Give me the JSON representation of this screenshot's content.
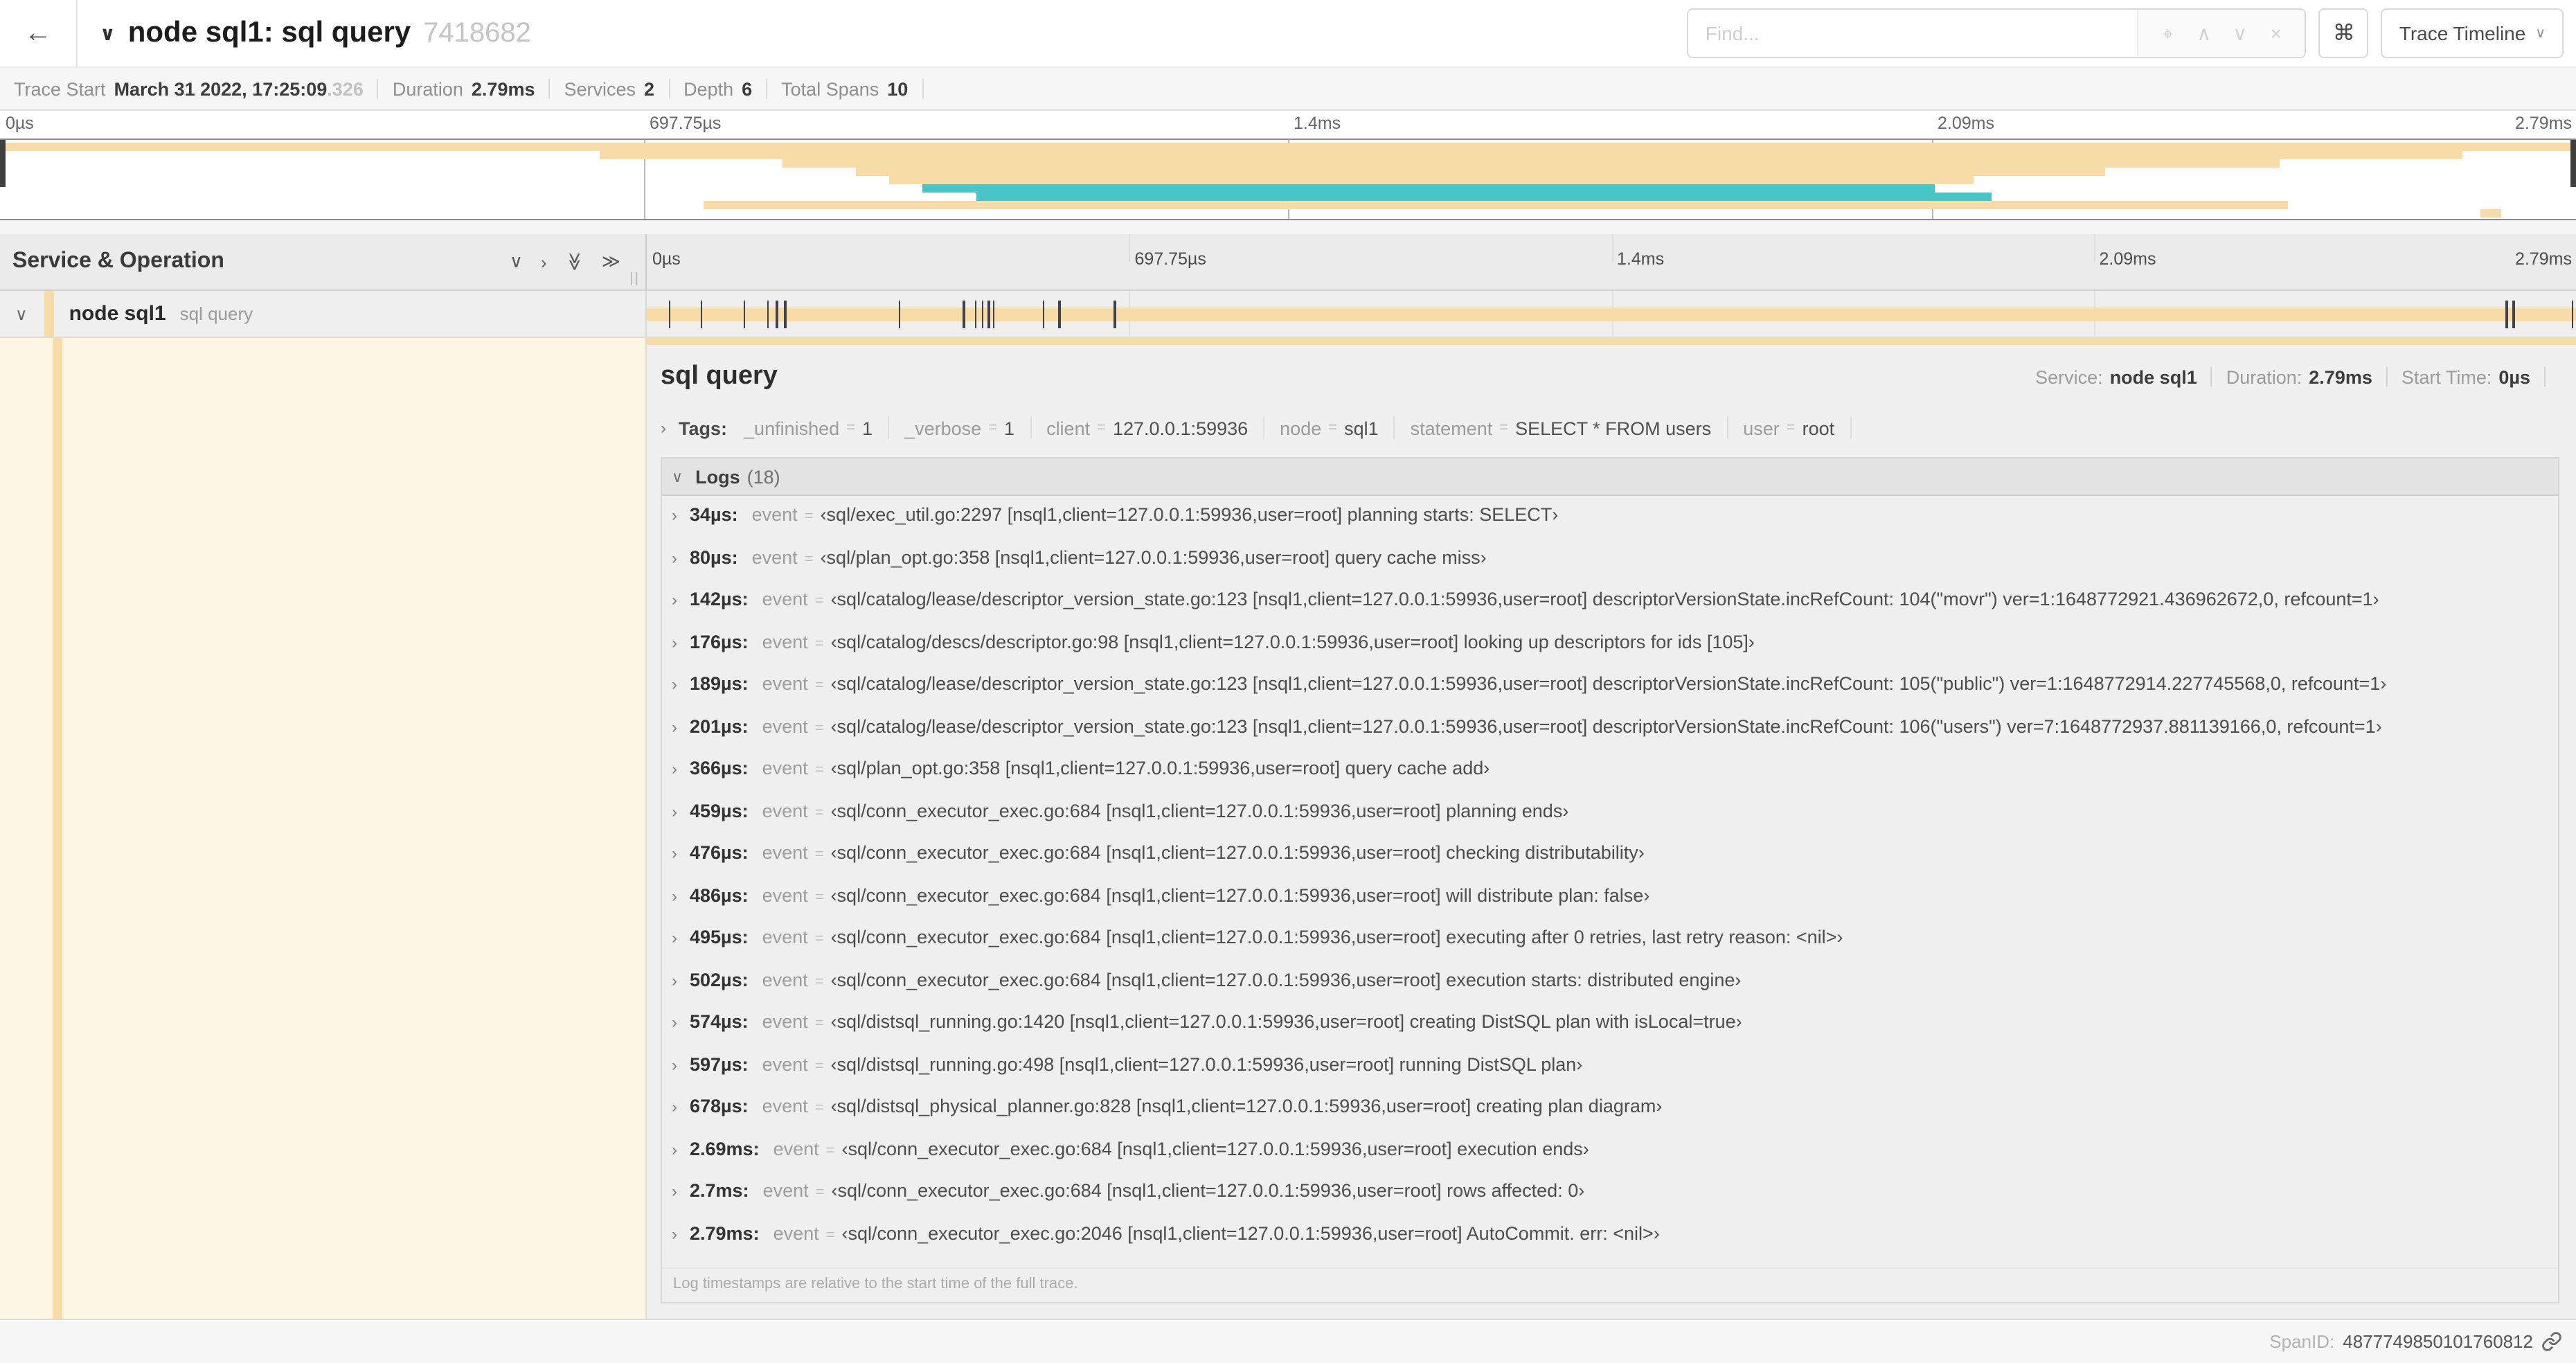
{
  "header": {
    "back_icon": "←",
    "collapse_icon": "∨",
    "title": "node sql1: sql query",
    "trace_id": "7418682",
    "find_placeholder": "Find...",
    "find_icons": [
      "⌖",
      "∧",
      "∨",
      "×"
    ],
    "shortcut_icon": "⌘",
    "view_selector": "Trace Timeline",
    "view_caret": "∨"
  },
  "summary": {
    "items": [
      {
        "label": "Trace Start",
        "value": "March 31 2022, 17:25:09",
        "extra": ".326"
      },
      {
        "label": "Duration",
        "value": "2.79ms",
        "extra": ""
      },
      {
        "label": "Services",
        "value": "2",
        "extra": ""
      },
      {
        "label": "Depth",
        "value": "6",
        "extra": ""
      },
      {
        "label": "Total Spans",
        "value": "10",
        "extra": ""
      }
    ]
  },
  "timeline": {
    "ticks": [
      {
        "label": "0µs",
        "pct": 0
      },
      {
        "label": "697.75µs",
        "pct": 25
      },
      {
        "label": "1.4ms",
        "pct": 50
      },
      {
        "label": "2.09ms",
        "pct": 75
      },
      {
        "label": "2.79ms",
        "pct": 100
      }
    ]
  },
  "colors": {
    "span_beige": "#f7dca8",
    "span_teal": "#48c5c7"
  },
  "minimap": {
    "rows": [
      {
        "start": 0,
        "end": 100,
        "color": "beige"
      },
      {
        "start": 23.3,
        "end": 95.6,
        "color": "beige"
      },
      {
        "start": 30.4,
        "end": 88.5,
        "color": "beige"
      },
      {
        "start": 33.2,
        "end": 81.7,
        "color": "beige"
      },
      {
        "start": 34.5,
        "end": 76.6,
        "color": "beige"
      },
      {
        "start": 35.8,
        "end": 75.1,
        "color": "teal"
      },
      {
        "start": 37.9,
        "end": 77.3,
        "color": "teal"
      },
      {
        "start": 27.3,
        "end": 88.8,
        "color": "beige"
      },
      {
        "start": 96.3,
        "end": 97.1,
        "color": "beige"
      }
    ]
  },
  "span_table": {
    "column_header": "Service & Operation",
    "collapse_icon": "∨",
    "expand_icon": "›",
    "collapse_all_icon": "≫",
    "expand_all_icon": "≫",
    "row_caret": "∨",
    "service": "node sql1",
    "operation": "sql query",
    "log_marker_pcts": [
      1.22,
      2.87,
      5.09,
      6.31,
      6.77,
      7.2,
      13.12,
      16.45,
      17.06,
      17.42,
      17.74,
      18.0,
      20.57,
      21.4,
      24.3,
      96.42,
      96.77,
      99.85
    ]
  },
  "detail": {
    "title": "sql query",
    "meta": [
      {
        "label": "Service:",
        "value": "node sql1"
      },
      {
        "label": "Duration:",
        "value": "2.79ms"
      },
      {
        "label": "Start Time:",
        "value": "0µs"
      }
    ],
    "tags_caret": "›",
    "tags_label": "Tags:",
    "tags": [
      {
        "key": "_unfinished",
        "value": "1"
      },
      {
        "key": "_verbose",
        "value": "1"
      },
      {
        "key": "client",
        "value": "127.0.0.1:59936"
      },
      {
        "key": "node",
        "value": "sql1"
      },
      {
        "key": "statement",
        "value": "SELECT * FROM users"
      },
      {
        "key": "user",
        "value": "root"
      }
    ],
    "logs_caret": "∨",
    "logs_label": "Logs",
    "logs_count": "(18)",
    "log_entries": [
      {
        "caret": "›",
        "time": "34µs:",
        "field": "event",
        "value": "‹sql/exec_util.go:2297 [nsql1,client=127.0.0.1:59936,user=root] planning starts: SELECT›"
      },
      {
        "caret": "›",
        "time": "80µs:",
        "field": "event",
        "value": "‹sql/plan_opt.go:358 [nsql1,client=127.0.0.1:59936,user=root] query cache miss›"
      },
      {
        "caret": "›",
        "time": "142µs:",
        "field": "event",
        "value": "‹sql/catalog/lease/descriptor_version_state.go:123 [nsql1,client=127.0.0.1:59936,user=root] descriptorVersionState.incRefCount: 104(\"movr\") ver=1:1648772921.436962672,0, refcount=1›"
      },
      {
        "caret": "›",
        "time": "176µs:",
        "field": "event",
        "value": "‹sql/catalog/descs/descriptor.go:98 [nsql1,client=127.0.0.1:59936,user=root] looking up descriptors for ids [105]›"
      },
      {
        "caret": "›",
        "time": "189µs:",
        "field": "event",
        "value": "‹sql/catalog/lease/descriptor_version_state.go:123 [nsql1,client=127.0.0.1:59936,user=root] descriptorVersionState.incRefCount: 105(\"public\") ver=1:1648772914.227745568,0, refcount=1›"
      },
      {
        "caret": "›",
        "time": "201µs:",
        "field": "event",
        "value": "‹sql/catalog/lease/descriptor_version_state.go:123 [nsql1,client=127.0.0.1:59936,user=root] descriptorVersionState.incRefCount: 106(\"users\") ver=7:1648772937.881139166,0, refcount=1›"
      },
      {
        "caret": "›",
        "time": "366µs:",
        "field": "event",
        "value": "‹sql/plan_opt.go:358 [nsql1,client=127.0.0.1:59936,user=root] query cache add›"
      },
      {
        "caret": "›",
        "time": "459µs:",
        "field": "event",
        "value": "‹sql/conn_executor_exec.go:684 [nsql1,client=127.0.0.1:59936,user=root] planning ends›"
      },
      {
        "caret": "›",
        "time": "476µs:",
        "field": "event",
        "value": "‹sql/conn_executor_exec.go:684 [nsql1,client=127.0.0.1:59936,user=root] checking distributability›"
      },
      {
        "caret": "›",
        "time": "486µs:",
        "field": "event",
        "value": "‹sql/conn_executor_exec.go:684 [nsql1,client=127.0.0.1:59936,user=root] will distribute plan: false›"
      },
      {
        "caret": "›",
        "time": "495µs:",
        "field": "event",
        "value": "‹sql/conn_executor_exec.go:684 [nsql1,client=127.0.0.1:59936,user=root] executing after 0 retries, last retry reason: <nil>›"
      },
      {
        "caret": "›",
        "time": "502µs:",
        "field": "event",
        "value": "‹sql/conn_executor_exec.go:684 [nsql1,client=127.0.0.1:59936,user=root] execution starts: distributed engine›"
      },
      {
        "caret": "›",
        "time": "574µs:",
        "field": "event",
        "value": "‹sql/distsql_running.go:1420 [nsql1,client=127.0.0.1:59936,user=root] creating DistSQL plan with isLocal=true›"
      },
      {
        "caret": "›",
        "time": "597µs:",
        "field": "event",
        "value": "‹sql/distsql_running.go:498 [nsql1,client=127.0.0.1:59936,user=root] running DistSQL plan›"
      },
      {
        "caret": "›",
        "time": "678µs:",
        "field": "event",
        "value": "‹sql/distsql_physical_planner.go:828 [nsql1,client=127.0.0.1:59936,user=root] creating plan diagram›"
      },
      {
        "caret": "›",
        "time": "2.69ms:",
        "field": "event",
        "value": "‹sql/conn_executor_exec.go:684 [nsql1,client=127.0.0.1:59936,user=root] execution ends›"
      },
      {
        "caret": "›",
        "time": "2.7ms:",
        "field": "event",
        "value": "‹sql/conn_executor_exec.go:684 [nsql1,client=127.0.0.1:59936,user=root] rows affected: 0›"
      },
      {
        "caret": "›",
        "time": "2.79ms:",
        "field": "event",
        "value": "‹sql/conn_executor_exec.go:2046 [nsql1,client=127.0.0.1:59936,user=root] AutoCommit. err: <nil>›"
      }
    ],
    "logs_note": "Log timestamps are relative to the start time of the full trace.",
    "span_id_label": "SpanID:",
    "span_id": "4877749850101760812"
  }
}
